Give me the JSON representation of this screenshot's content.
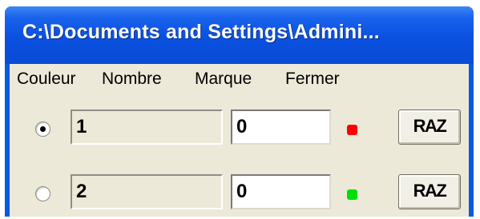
{
  "window": {
    "title": "C:\\Documents and Settings\\Admini..."
  },
  "menu": [
    "Couleur",
    "Nombre",
    "Marque",
    "Fermer"
  ],
  "rows": [
    {
      "id": "1",
      "value": "0",
      "selected": true,
      "indicator_color": "#ff0000",
      "reset_label": "RAZ"
    },
    {
      "id": "2",
      "value": "0",
      "selected": false,
      "indicator_color": "#00e000",
      "reset_label": "RAZ"
    }
  ],
  "colors": {
    "titlebar": "#0a50df",
    "client_bg": "#ece9d8"
  },
  "icons": {
    "selected_radio": "radio-selected-icon",
    "unselected_radio": "radio-unselected-icon",
    "indicator": "status-led-icon"
  }
}
